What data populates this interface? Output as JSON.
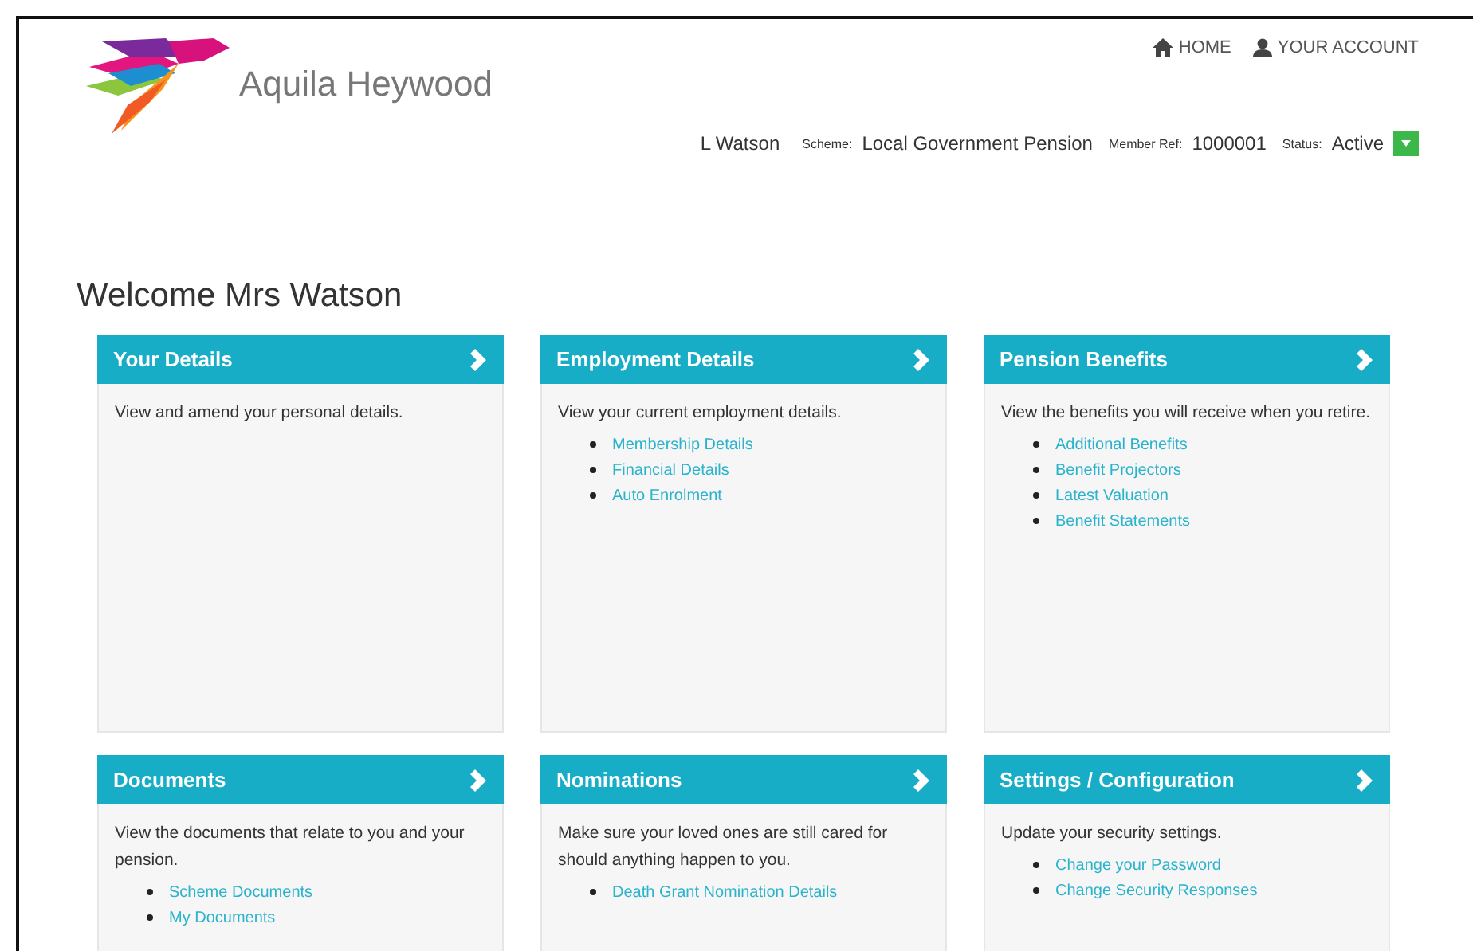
{
  "brand": {
    "name": "Aquila Heywood"
  },
  "nav": [
    {
      "kind": "home",
      "label": "HOME"
    },
    {
      "kind": "account",
      "label": "YOUR ACCOUNT"
    }
  ],
  "member": {
    "name": "L Watson",
    "scheme_label": "Scheme:",
    "scheme": "Local Government Pension",
    "ref_label": "Member Ref:",
    "ref": "1000001",
    "status_label": "Status:",
    "status": "Active"
  },
  "welcome": "Welcome Mrs Watson",
  "cards": [
    {
      "title": "Your Details",
      "text": "View and amend your personal details."
    },
    {
      "title": "Employment Details",
      "text": "View your current employment details.",
      "links": [
        "Membership Details",
        "Financial Details",
        "Auto Enrolment"
      ]
    },
    {
      "title": "Pension Benefits",
      "text": "View the benefits you will receive when you retire.",
      "links": [
        "Additional Benefits",
        "Benefit Projectors",
        "Latest Valuation",
        "Benefit Statements"
      ]
    },
    {
      "title": "Documents",
      "text": "View the documents that relate to you and your pension.",
      "links": [
        "Scheme Documents",
        "My Documents"
      ]
    },
    {
      "title": "Nominations",
      "text": "Make sure your loved ones are still cared for should anything happen to you.",
      "links": [
        "Death Grant Nomination Details"
      ]
    },
    {
      "title": "Settings / Configuration",
      "text": "Update your security settings.",
      "links": [
        "Change your Password",
        "Change Security Responses"
      ]
    }
  ]
}
